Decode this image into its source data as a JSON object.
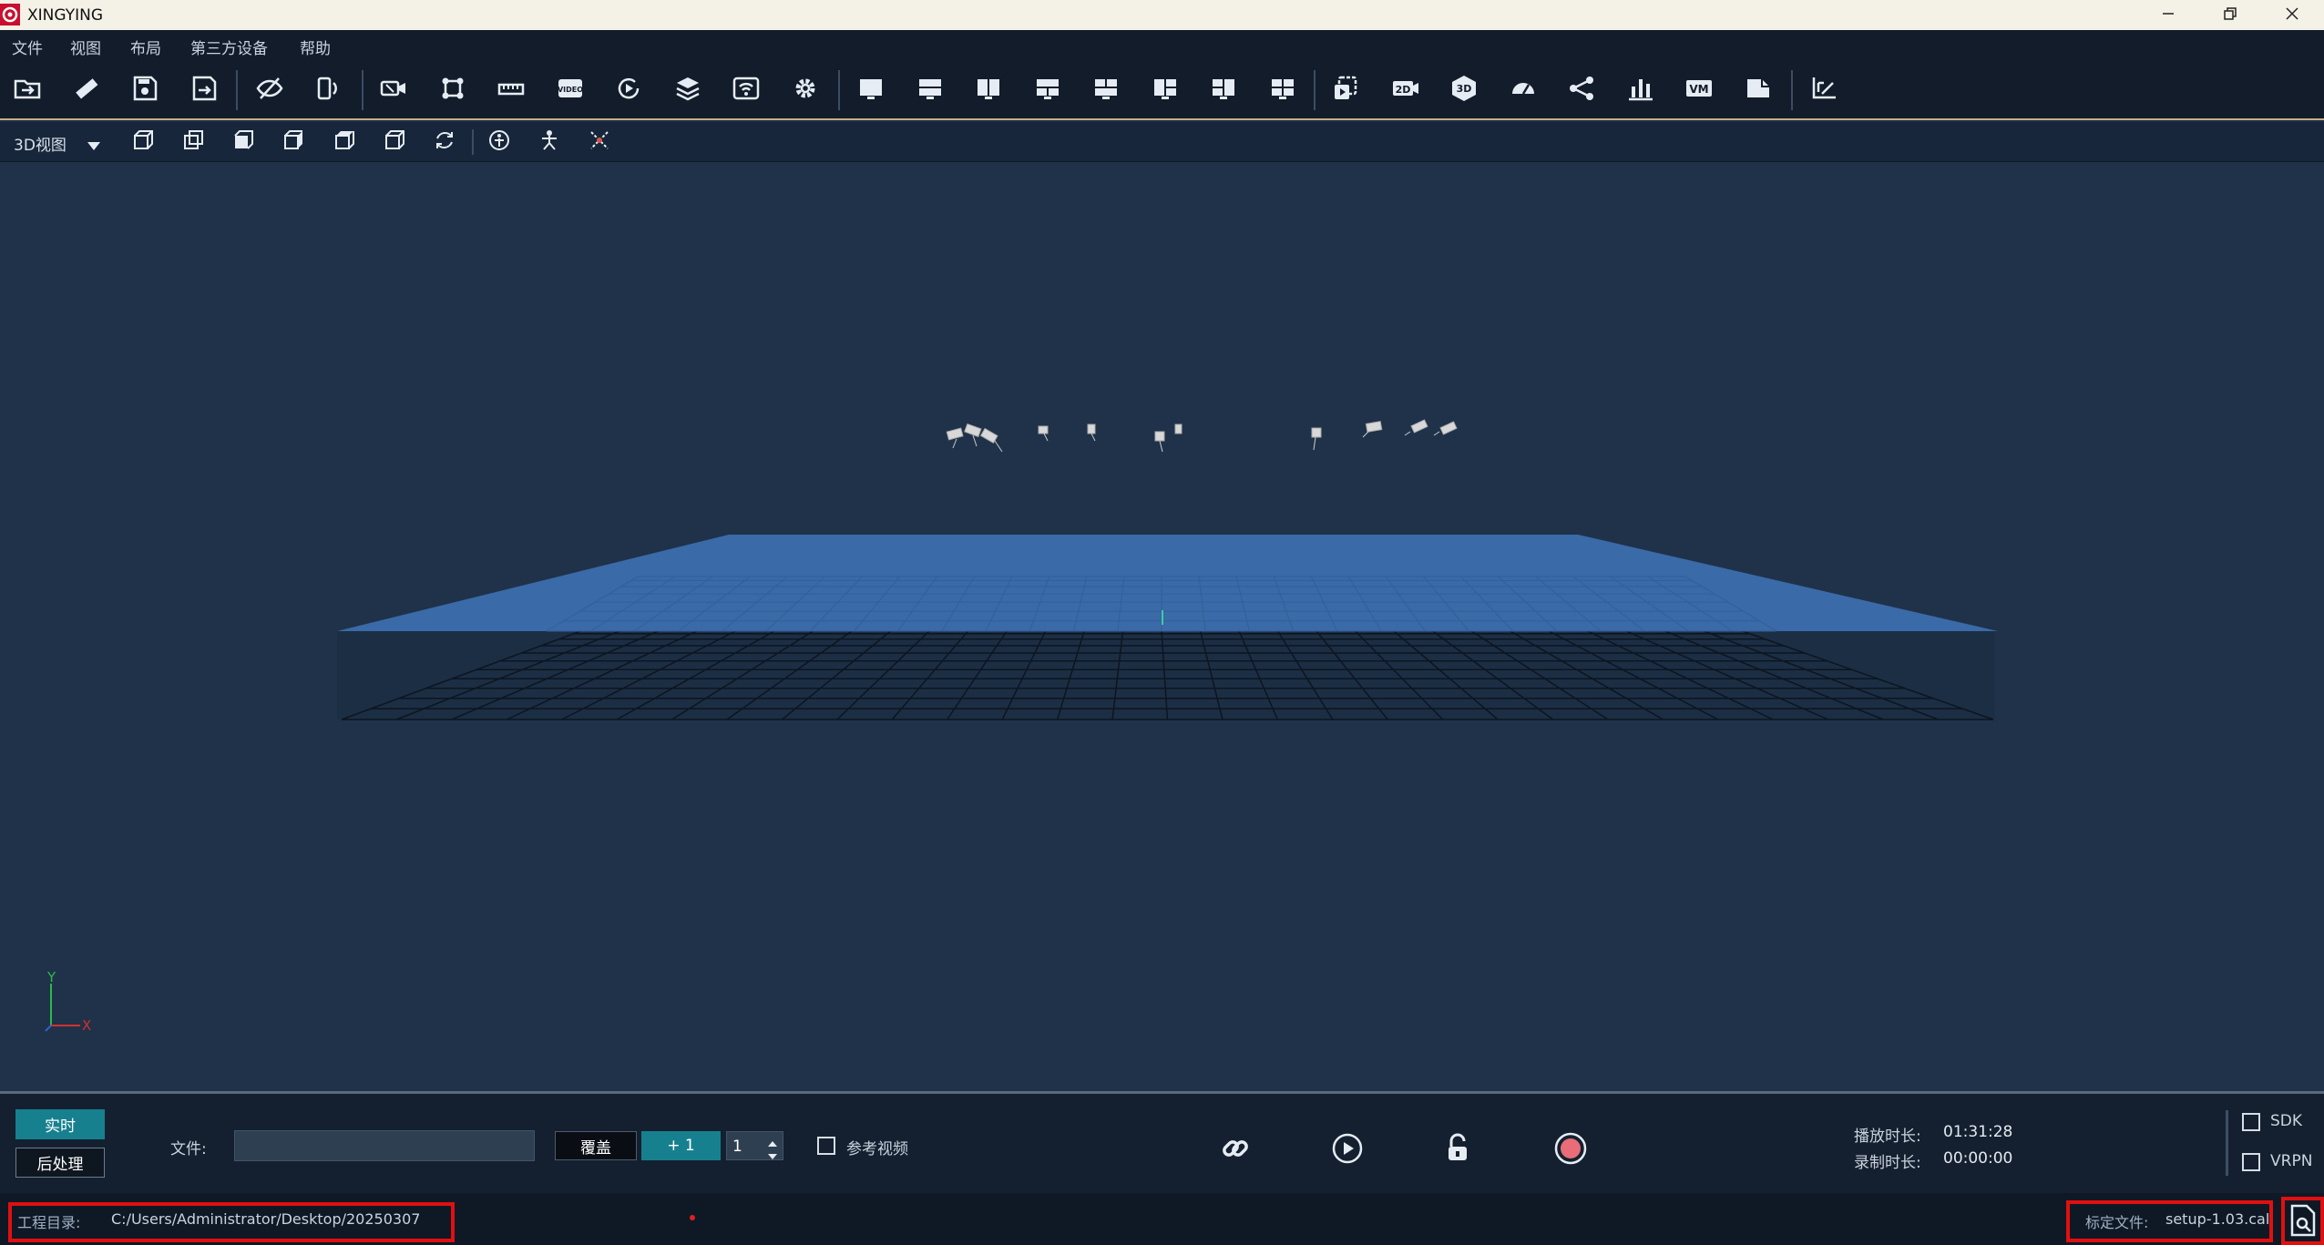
{
  "window": {
    "title": "XINGYING",
    "controls": [
      "minimize-icon",
      "restore-icon",
      "close-icon"
    ]
  },
  "menu": {
    "items": [
      "文件",
      "视图",
      "布局",
      "第三方设备",
      "帮助"
    ]
  },
  "toolbar": {
    "icons": [
      "open-folder-icon",
      "ruler-icon",
      "save-icon",
      "save-as-icon",
      "hide-icon",
      "rotate-view-icon",
      "camera-icon",
      "transform-icon",
      "measure-icon",
      "video-icon",
      "playback-icon",
      "layers-icon",
      "wireless-icon",
      "settings-icon",
      "layout-single-icon",
      "layout-2h-icon",
      "layout-2v-icon",
      "layout-3-top-icon",
      "layout-3-bottom-icon",
      "layout-3-left-icon",
      "layout-3-right-icon",
      "layout-4-icon",
      "record-clip-icon",
      "view-2d-icon",
      "view-3d-icon",
      "speed-icon",
      "skeleton-icon",
      "chart-icon",
      "vm-icon",
      "document-icon",
      "force-plate-icon"
    ],
    "text_icons": {
      "view-2d-icon": "2D",
      "view-3d-icon": "3D",
      "vm-icon": "VM",
      "video-icon": "VIDEO"
    }
  },
  "viewbar": {
    "view_mode": "3D视图",
    "icons": [
      "cube-front-icon",
      "cube-back-icon",
      "cube-left-icon",
      "cube-right-icon",
      "cube-top-icon",
      "cube-bottom-icon",
      "refresh-icon",
      "person-icon",
      "skeleton-view-icon",
      "marker-icon"
    ]
  },
  "viewport": {
    "axis_labels": {
      "y": "Y",
      "x": "X"
    },
    "colors": {
      "background": "#1f3249",
      "floor": "#3b6aa6",
      "grid": "#0d1622"
    }
  },
  "bottom": {
    "mode_live": "实时",
    "mode_post": "后处理",
    "file_label": "文件:",
    "file_value": "",
    "overwrite_label": "覆盖",
    "plus_one_label": "+ 1",
    "increment_value": "1",
    "ref_video_label": "参考视频",
    "play_duration_label": "播放时长:",
    "play_duration_value": "01:31:28",
    "record_duration_label": "录制时长:",
    "record_duration_value": "00:00:00",
    "sdk_label": "SDK",
    "vrpn_label": "VRPN",
    "transport_icons": [
      "link-icon",
      "play-icon",
      "unlock-icon",
      "record-icon"
    ]
  },
  "status": {
    "project_dir_label": "工程目录:",
    "project_dir_value": "C:/Users/Administrator/Desktop/20250307",
    "calibration_label": "标定文件:",
    "calibration_value": "setup-1.03.cal"
  }
}
